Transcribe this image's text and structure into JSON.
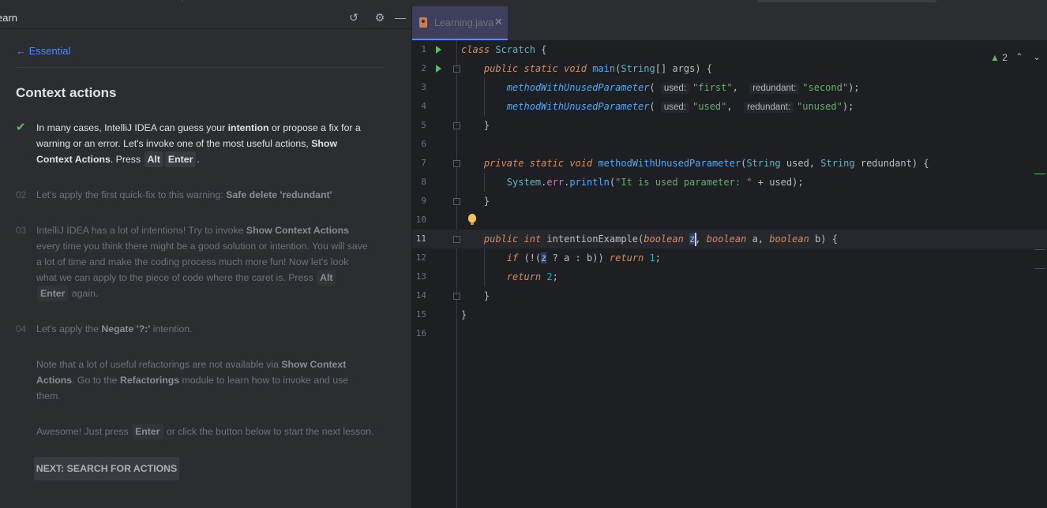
{
  "learn": {
    "title": "earn",
    "back": "Essential",
    "lesson_title": "Context actions",
    "step1": {
      "t1": "In many cases, IntelliJ IDEA can guess your ",
      "b1": "intention",
      "t2": " or propose a fix for a warning or an error. Let's invoke one of the most useful actions, ",
      "b2": "Show Context Actions",
      "t3": ". Press ",
      "k1": "Alt",
      "k2": "Enter",
      "t4": "."
    },
    "step2": {
      "num": "02",
      "t1": "Let's apply the first quick-fix to this warning: ",
      "b1": "Safe delete 'redundant'"
    },
    "step3": {
      "num": "03",
      "t1": "IntelliJ IDEA has a lot of intentions! Try to invoke ",
      "b1": "Show Context Actions",
      "t2": " every time you think there might be a good solution or intention. You will save a lot of time and make the coding process much more fun! Now let's look what we can apply to the piece of code where the caret is. Press ",
      "k1": "Alt",
      "k2": "Enter",
      "t3": " again."
    },
    "step4": {
      "num": "04",
      "t1": "Let's apply the ",
      "b1": "Negate '?:'",
      "t2": " intention."
    },
    "note": {
      "t1": "Note that a lot of useful refactorings are not available via ",
      "b1": "Show Context Actions",
      "t2": ". Go to the ",
      "b2": "Refactorings",
      "t3": " module to learn how to invoke and use them."
    },
    "awesome": {
      "t1": "Awesome! Just press ",
      "k1": "Enter",
      "t2": " or click the button below to start the next lesson."
    },
    "next_button": "NEXT: SEARCH FOR ACTIONS"
  },
  "editor": {
    "tab": "Learning.java",
    "warnings": "2",
    "current_line": 11,
    "line_numbers": [
      "1",
      "2",
      "3",
      "4",
      "5",
      "6",
      "7",
      "8",
      "9",
      "10",
      "11",
      "12",
      "13",
      "14",
      "15",
      "16"
    ],
    "code": {
      "l1_class": "class",
      "l1_name": "Scratch",
      "l2_public": "public",
      "l2_static": "static",
      "l2_void": "void",
      "l2_main": "main",
      "l2_string": "String",
      "l2_args": "args",
      "call_name": "methodWithUnusedParameter",
      "hint_used": "used:",
      "hint_redundant": "redundant:",
      "l3_arg1": "\"first\"",
      "l3_arg2": "\"second\"",
      "l4_arg1": "\"used\"",
      "l4_arg2": "\"unused\"",
      "l7_private": "private",
      "l7_string": "String",
      "l7_used": "used",
      "l7_redundant": "redundant",
      "l8_system": "System",
      "l8_err": "err",
      "l8_println": "println",
      "l8_str": "\"It is used parameter: \"",
      "l8_used": "used",
      "l11_int": "int",
      "l11_name": "intentionExample",
      "l11_boolean": "boolean",
      "l11_z": "z",
      "l11_a": "a",
      "l11_b": "b",
      "l12_if": "if",
      "l12_return": "return",
      "l12_one": "1",
      "l13_two": "2"
    }
  }
}
